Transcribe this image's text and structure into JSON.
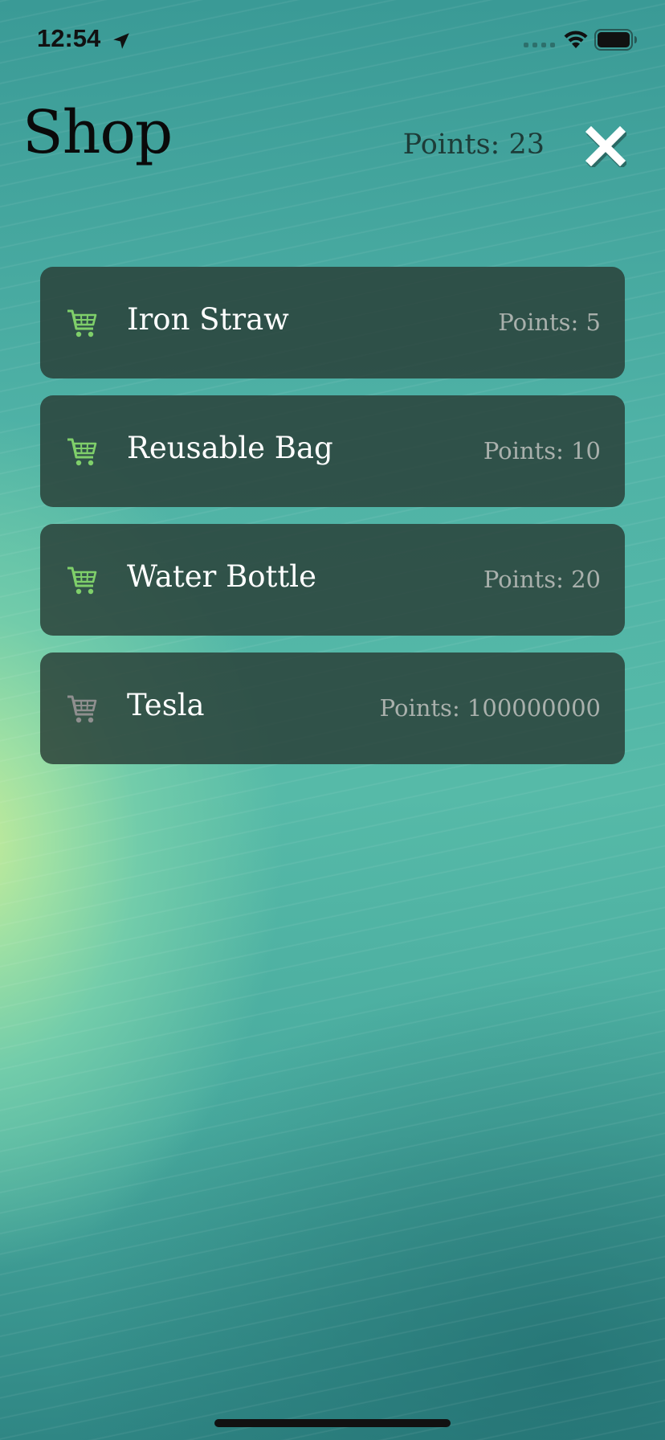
{
  "status_bar": {
    "time": "12:54",
    "icons": [
      "location-arrow-icon",
      "cellular-signal-icon",
      "wifi-icon",
      "battery-icon"
    ]
  },
  "header": {
    "title": "Shop",
    "points_label": "Points: 23",
    "close_icon": "close-icon"
  },
  "items": [
    {
      "name": "Iron Straw",
      "price": "Points: 5",
      "icon": "cart-icon",
      "affordable": true
    },
    {
      "name": "Reusable Bag",
      "price": "Points: 10",
      "icon": "cart-icon",
      "affordable": true
    },
    {
      "name": "Water Bottle",
      "price": "Points: 20",
      "icon": "cart-icon",
      "affordable": true
    },
    {
      "name": "Tesla",
      "price": "Points: 100000000",
      "icon": "cart-icon",
      "affordable": false
    }
  ],
  "colors": {
    "cart_available": "#7fcf6a",
    "cart_unavailable": "#8f8f8f",
    "card_background": "#283c34",
    "price_text": "#a9b0ac"
  }
}
